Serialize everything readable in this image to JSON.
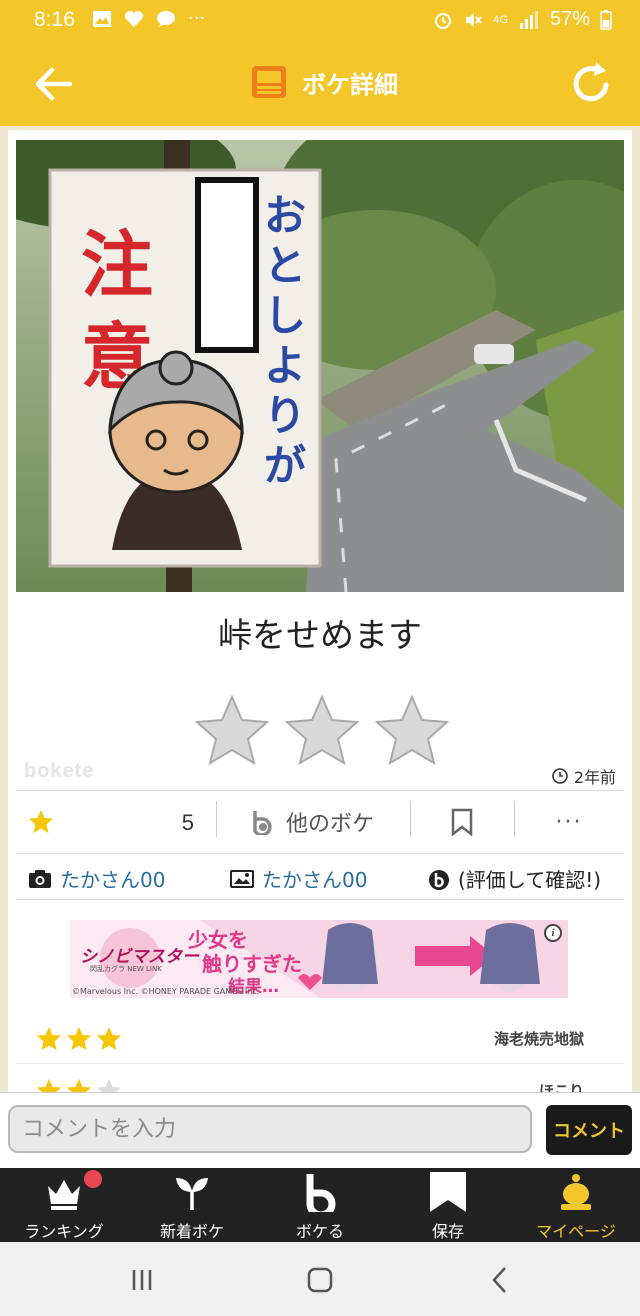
{
  "status_bar": {
    "time": "8:16",
    "extra": "···",
    "network": "4G",
    "battery": "57%"
  },
  "app_bar": {
    "title": "ボケ詳細"
  },
  "post": {
    "photo": {
      "sign_red_text": "注意",
      "sign_blue_text": "おとしよりが"
    },
    "boke_text": "峠をせめます",
    "watermark": "bokete",
    "posted_ago": "2年前",
    "star_count": "5",
    "other_boke_label": "他のボケ",
    "more_label": "···",
    "photo_credit": "たかさん00",
    "image_credit": "たかさん00",
    "boke_author": "(評価して確認!)"
  },
  "ad": {
    "logo_text": "シノビマスター",
    "logo_sub": "閃乱カグラ NEW LINK",
    "headline_1": "少女を",
    "headline_2": "触りすぎた",
    "headline_3": "結果…",
    "copyright": "©Marvelous Inc. ©HONEY PARADE GAMES Inc.",
    "info": "i"
  },
  "ratings": [
    {
      "stars": 3,
      "user": "海老焼売地獄"
    },
    {
      "stars": 2,
      "user": "ほこり"
    }
  ],
  "comment": {
    "placeholder": "コメントを入力",
    "button": "コメント"
  },
  "bottom_nav": {
    "items": [
      {
        "label": "ランキング",
        "icon": "crown-icon"
      },
      {
        "label": "新着ボケ",
        "icon": "sprout-icon"
      },
      {
        "label": "ボケる",
        "icon": "bokete-b-icon"
      },
      {
        "label": "保存",
        "icon": "bookmark-icon"
      },
      {
        "label": "マイページ",
        "icon": "person-icon"
      }
    ]
  },
  "colors": {
    "brand_yellow": "#f3c62a",
    "star_gold": "#f6c700",
    "link_blue": "#2a6d9e",
    "nav_dark": "#222222"
  }
}
